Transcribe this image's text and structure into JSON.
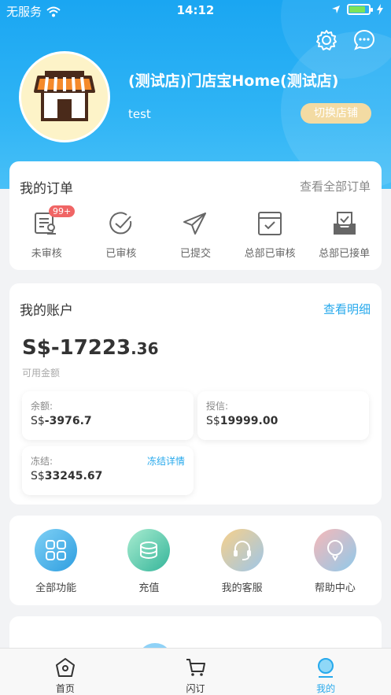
{
  "status_bar": {
    "carrier": "无服务",
    "time": "14:12"
  },
  "header": {
    "store_name": "(测试店)门店宝Home(测试店)",
    "user": "test",
    "switch_label": "切换店铺",
    "icons": [
      "settings-icon",
      "message-icon"
    ]
  },
  "orders": {
    "title": "我的订单",
    "view_all": "查看全部订单",
    "items": [
      {
        "label": "未审核",
        "badge": "99+",
        "icon": "pending-review-icon"
      },
      {
        "label": "已审核",
        "icon": "reviewed-icon"
      },
      {
        "label": "已提交",
        "icon": "submitted-icon"
      },
      {
        "label": "总部已审核",
        "icon": "hq-reviewed-icon"
      },
      {
        "label": "总部已接单",
        "icon": "hq-accepted-icon"
      }
    ]
  },
  "account": {
    "title": "我的账户",
    "detail_link": "查看明细",
    "balance_prefix": "S$-17223",
    "balance_decimal": ".36",
    "balance_label": "可用金额",
    "boxes": {
      "remaining": {
        "label": "余额:",
        "currency": "S$",
        "value": "-3976.7"
      },
      "credit": {
        "label": "授信:",
        "currency": "S$",
        "value": "19999.00"
      },
      "frozen": {
        "label": "冻结:",
        "currency": "S$",
        "value": "33245.67",
        "link": "冻结详情"
      }
    }
  },
  "functions": {
    "items": [
      {
        "label": "全部功能",
        "icon": "all-functions-icon"
      },
      {
        "label": "充值",
        "icon": "recharge-icon"
      },
      {
        "label": "我的客服",
        "icon": "customer-service-icon"
      },
      {
        "label": "帮助中心",
        "icon": "help-center-icon"
      }
    ]
  },
  "tabbar": {
    "tabs": [
      {
        "label": "首页",
        "icon": "home-icon"
      },
      {
        "label": "闪订",
        "icon": "cart-icon"
      },
      {
        "label": "我的",
        "icon": "profile-icon",
        "active": true
      }
    ]
  },
  "colors": {
    "header_blue": "#1aa6f2",
    "accent_blue": "#27a9ec",
    "badge_red": "#f06565",
    "switch_gold": "#f3dba3"
  }
}
